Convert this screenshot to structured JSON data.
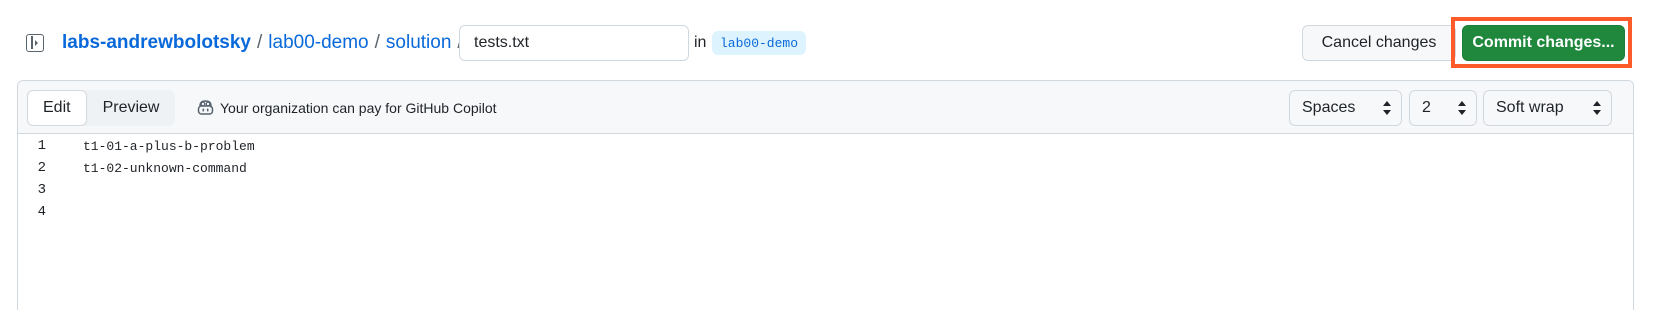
{
  "breadcrumb": {
    "owner": "labs-andrewbolotsky",
    "repo": "lab00-demo",
    "folder": "solution",
    "separator": "/"
  },
  "filename": {
    "value": "tests.txt"
  },
  "branch": {
    "in_label": "in",
    "name": "lab00-demo"
  },
  "actions": {
    "cancel_label": "Cancel changes",
    "commit_label": "Commit changes..."
  },
  "editor": {
    "tabs": [
      {
        "label": "Edit",
        "active": true
      },
      {
        "label": "Preview",
        "active": false
      }
    ],
    "copilot_text": "Your organization can pay for GitHub Copilot",
    "indent_mode": "Spaces",
    "indent_size": "2",
    "wrap_mode": "Soft wrap",
    "lines": [
      {
        "number": "1",
        "text": "t1-01-a-plus-b-problem"
      },
      {
        "number": "2",
        "text": "t1-02-unknown-command"
      },
      {
        "number": "3",
        "text": ""
      },
      {
        "number": "4",
        "text": ""
      }
    ]
  },
  "colors": {
    "link": "#0969da",
    "commit_button": "#1f883d",
    "highlight_box": "#fe5b2a",
    "branch_pill_bg": "#ddf4ff"
  },
  "icons": {
    "sidebar_toggle": "sidebar-toggle-icon",
    "copilot": "copilot-icon",
    "select_caret": "chevron-up-down-icon"
  }
}
